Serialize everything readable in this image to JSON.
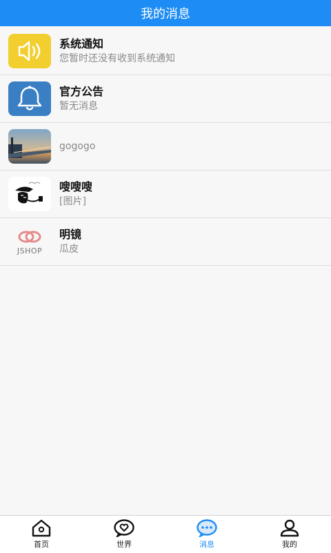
{
  "header": {
    "title": "我的消息"
  },
  "messages": [
    {
      "title": "系统通知",
      "subtitle": "您暂时还没有收到系统通知",
      "icon": "speaker-icon",
      "color": "#f2cf2f"
    },
    {
      "title": "官方公告",
      "subtitle": "暂无消息",
      "icon": "bell-icon",
      "color": "#3a7ec4"
    },
    {
      "title": "",
      "subtitle": "gogogo",
      "icon": "bridge-photo"
    },
    {
      "title": "嗖嗖嗖",
      "subtitle": "[图片]",
      "icon": "smoking-character-avatar"
    },
    {
      "title": "明镜",
      "subtitle": "瓜皮",
      "icon": "jshop-logo",
      "logo_text": "JSHOP"
    }
  ],
  "tabbar": {
    "items": [
      {
        "label": "首页",
        "icon": "home-icon"
      },
      {
        "label": "世界",
        "icon": "heart-bubble-icon"
      },
      {
        "label": "消息",
        "icon": "chat-icon",
        "active": true
      },
      {
        "label": "我的",
        "icon": "user-icon"
      }
    ],
    "active_color": "#1e8cf5"
  }
}
